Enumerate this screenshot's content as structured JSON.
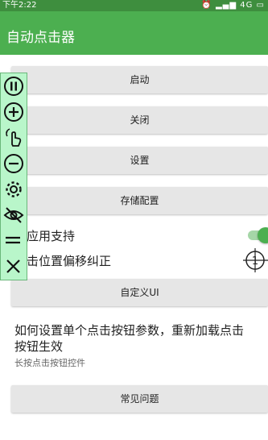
{
  "status_bar": {
    "time": "下午2:22",
    "icons": [
      "alarm-icon",
      "signal-icon",
      "4g-icon"
    ],
    "network_label": "4G"
  },
  "app_bar": {
    "title": "自动点击器"
  },
  "buttons": {
    "start": "启动",
    "close": "关闭",
    "settings": "设置",
    "save_config": "存储配置",
    "custom_ui": "自定义UI",
    "faq": "常见问题"
  },
  "settings_rows": {
    "cross_app_label": "跨应用支持",
    "cross_app_enabled": true,
    "offset_label": "点击位置偏移纠正"
  },
  "crosshair_target_number": "1",
  "tip": {
    "title_line1": "如何设置单个点击按钮参数，重新加载点击",
    "title_line2": "按钮生效",
    "subtitle": "长按点击按钮控件"
  },
  "floating_toolbar": {
    "icons": [
      "pause-icon",
      "add-icon",
      "tap-gesture-icon",
      "remove-icon",
      "gear-icon",
      "eye-off-icon",
      "drag-handle-icon",
      "close-icon"
    ]
  },
  "colors": {
    "app_bar": "#4caf50",
    "status_bar": "#3e8e3e",
    "floating_toolbar": "#b9f6ca",
    "button": "#e6e6e6"
  }
}
